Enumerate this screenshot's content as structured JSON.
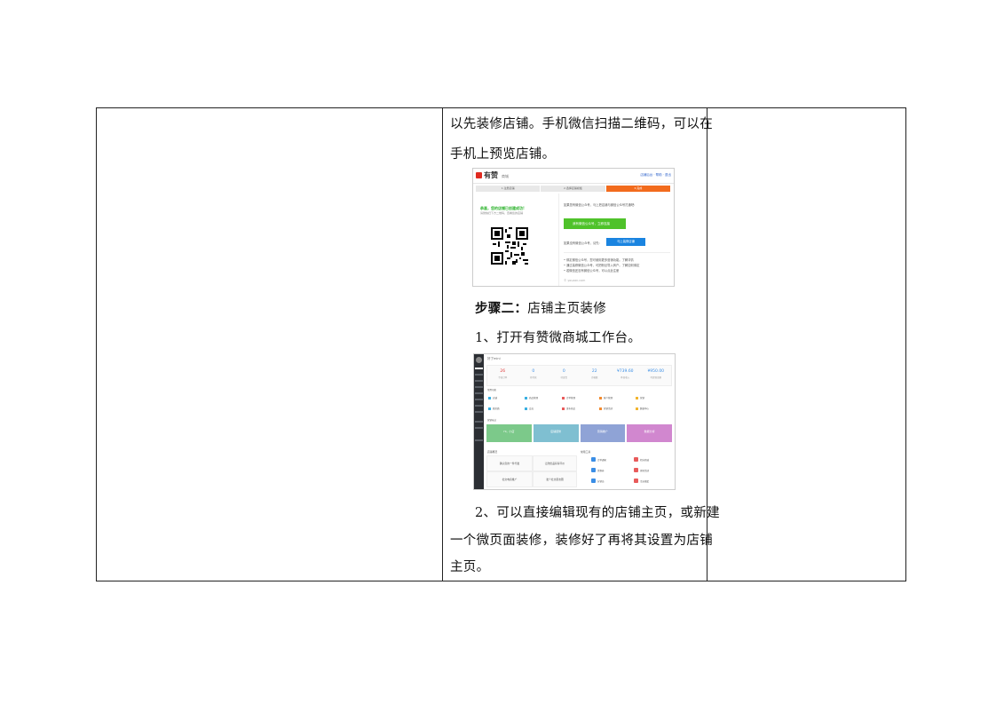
{
  "document": {
    "paragraphs": [
      "以先装修店铺。手机微信扫描二维码，可以在",
      "手机上预览店铺。",
      "1、打开有赞微商城工作台。",
      "2、可以直接编辑现有的店铺主页，或新建",
      "一个微页面装修，装修好了再将其设置为店铺",
      "主页。"
    ],
    "step_heading": {
      "label": "步骤二：",
      "text": "店铺主页装修"
    }
  },
  "screenshot1": {
    "logo": "有赞",
    "logo_sub": "商城",
    "header_links": "店铺后台 · 帮助 · 退出",
    "steps": [
      "1.注册店铺",
      "2.选择店铺模板",
      "3.完成"
    ],
    "success": "恭喜，您的店铺已创建成功!",
    "hint": "请微信扫下方二维码，查看您的店铺",
    "line1": "如果您有微信公众号，马上把店铺与微信公众号打通吧:",
    "green_button": "我有微信公众号，立即连接",
    "line2": "如果没有微信公众号，请先:",
    "blue_button": "马上装修店铺",
    "tips": [
      "• 绑定微信公众号，您可使用更多营销功能。了解详情",
      "• 通过装修微信公众号，可把粉丝导入商户。了解如何绑定",
      "• 若微信还没有微信公众号，可以点此注册"
    ],
    "footer": "© youzan.com",
    "colors": {
      "accent": "#f26b1d",
      "green": "#4fc22a",
      "blue": "#1a84e0",
      "brand_red": "#e02a20"
    }
  },
  "screenshot2": {
    "title": "好了mini",
    "stats": [
      {
        "value": "26",
        "label": "今日订单"
      },
      {
        "value": "0",
        "label": "待付款"
      },
      {
        "value": "0",
        "label": "待发货"
      },
      {
        "value": "22",
        "label": "访客数"
      },
      {
        "value": "¥739.60",
        "label": "昨日收入"
      },
      {
        "value": "¥950.00",
        "label": "可提现金额"
      }
    ],
    "apps_label": "常用功能",
    "apps": [
      "店铺",
      "商品管理",
      "订单管理",
      "客户管理",
      "营销",
      "微页面",
      "会员",
      "发布商品",
      "营销活动",
      "数据中心"
    ],
    "tiles_label": "营销玩法",
    "tiles": [
      "Hi，小店",
      "店铺装修",
      "营销推广",
      "数据分析"
    ],
    "panel_left_label": "店铺概况",
    "panel_right_label": "常用工具",
    "boxes": [
      "确认您的一件代发",
      "让陆优品获得平价",
      "社交电商推广",
      "发个社交朋友圈"
    ],
    "tools": [
      "订单通知",
      "积分商城",
      "优惠券",
      "拼团活动",
      "分销员",
      "幸运抽奖"
    ]
  }
}
